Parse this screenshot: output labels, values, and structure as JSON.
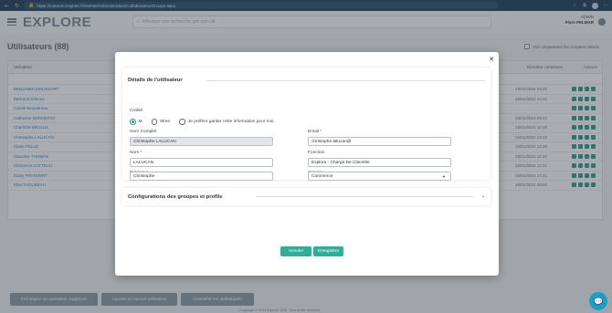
{
  "browser": {
    "url": "https://extranet.explore.fr/DotNet/Administration/CollaborateurGroupe.aspx",
    "back_icon": "arrow-left-icon",
    "refresh_icon": "refresh-icon"
  },
  "header": {
    "logo": "EXPLORE",
    "search_placeholder": "Effectuer une recherche par mot-clé",
    "user_label": "ADMIN",
    "user_name": "Flore PELMAR"
  },
  "page": {
    "title": "Utilisateurs (88)",
    "checkbox_label": "Voir uniquement les comptes utilisés",
    "columns": [
      "Utilisateur",
      "Dernière connexion",
      "Actions"
    ],
    "rows": [
      {
        "name": "BENJAMIN MOUSSART",
        "date": "19/01/2024 08:30"
      },
      {
        "name": "Bertrand Etienne",
        "date": "15/01/2024 12:20"
      },
      {
        "name": "Carole Mouadreau",
        "date": ""
      },
      {
        "name": "Catherine BONNEFOY",
        "date": "18/01/2024 09:14"
      },
      {
        "name": "Charlotte MEULLE",
        "date": "18/01/2024 10:15"
      },
      {
        "name": "Christophe LALUCAN",
        "date": "16/01/2024 14:20"
      },
      {
        "name": "Claire PELLE",
        "date": "18/01/2024 12:38"
      },
      {
        "name": "Claudine THOMAS",
        "date": "18/01/2024 11:34"
      },
      {
        "name": "Clémence CATTEAU",
        "date": "16/01/2024 11:44"
      },
      {
        "name": "Daisy PRANVERT",
        "date": "15/01/2024 17:21"
      },
      {
        "name": "Elsa THOUBEAU",
        "date": "18/01/2024 08:50"
      }
    ],
    "bottom_buttons": [
      "Réintégrer un utilisateur supprimé",
      "Ajouter un nouvel utilisateur",
      "Consulter les statistiques"
    ],
    "footer": "Copyright © 2024 Explore SAS. Tous droits réservés."
  },
  "modal": {
    "section_title": "Détails de l'utilisateur",
    "civility_label": "Civilité",
    "civility_options": [
      "M.",
      "Mme.",
      "Je préfère garder cette information pour moi"
    ],
    "civility_selected": "M.",
    "full_name_label": "Nom Complet",
    "full_name_value": "Christophe LALUCAN",
    "email_label": "Email",
    "email_value": "christophe.lalucan@",
    "last_name_label": "Nom",
    "last_name_value": "LALUCAN",
    "function_label": "Fonction",
    "function_value": "Explore - Chargé De Clientèle",
    "first_name_label": "Prénom",
    "first_name_value": "Christophe",
    "service_label": "Service",
    "service_value": "Commerce",
    "groups_title": "Configurations des groupes et profils",
    "cancel_label": "Annuler",
    "save_label": "Enregistrer",
    "required_mark": "*"
  },
  "colors": {
    "accent": "#2eae98",
    "header_bar": "#1f3b57",
    "chat": "#1a9fc8"
  }
}
